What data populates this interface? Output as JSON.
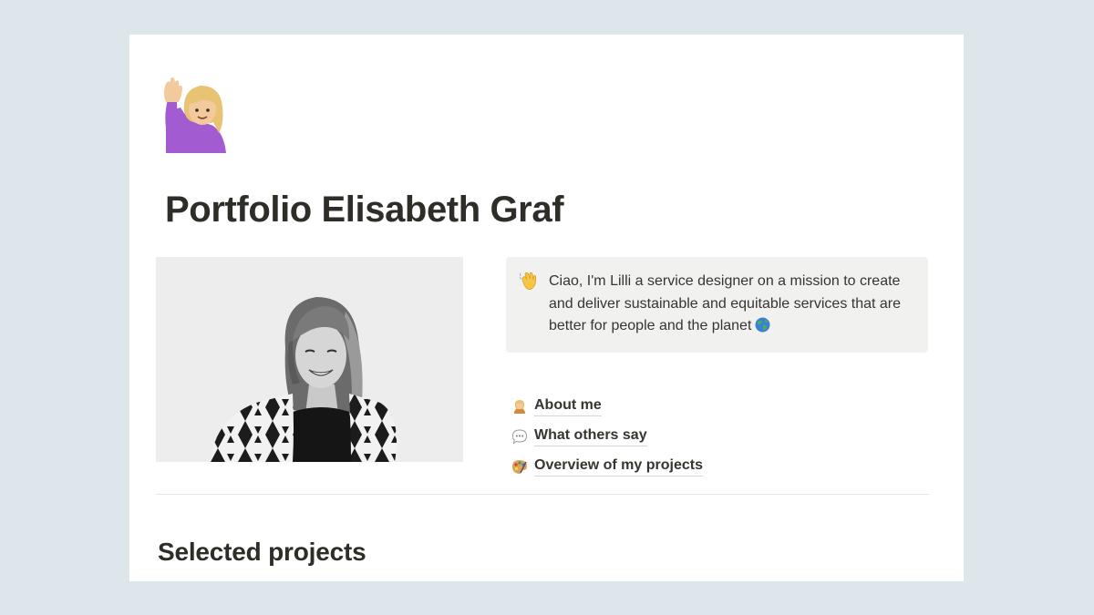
{
  "page": {
    "title": "Portfolio Elisabeth Graf",
    "icon": "woman-raising-hand-icon"
  },
  "callout": {
    "icon": "waving-hand-icon",
    "text": "Ciao, I'm Lilli a service designer on a mission to create and deliver sustainable and equitable services that are better for people and the planet",
    "trailing_icon": "globe-icon"
  },
  "links": [
    {
      "label": "About me",
      "icon": "person-icon"
    },
    {
      "label": "What others say",
      "icon": "speech-bubble-icon"
    },
    {
      "label": "Overview of my projects",
      "icon": "palette-icon"
    }
  ],
  "section": {
    "heading": "Selected projects"
  },
  "colors": {
    "background": "#dce6eb",
    "page": "#ffffff",
    "callout_bg": "#f1f1ef",
    "text": "#37352f"
  }
}
